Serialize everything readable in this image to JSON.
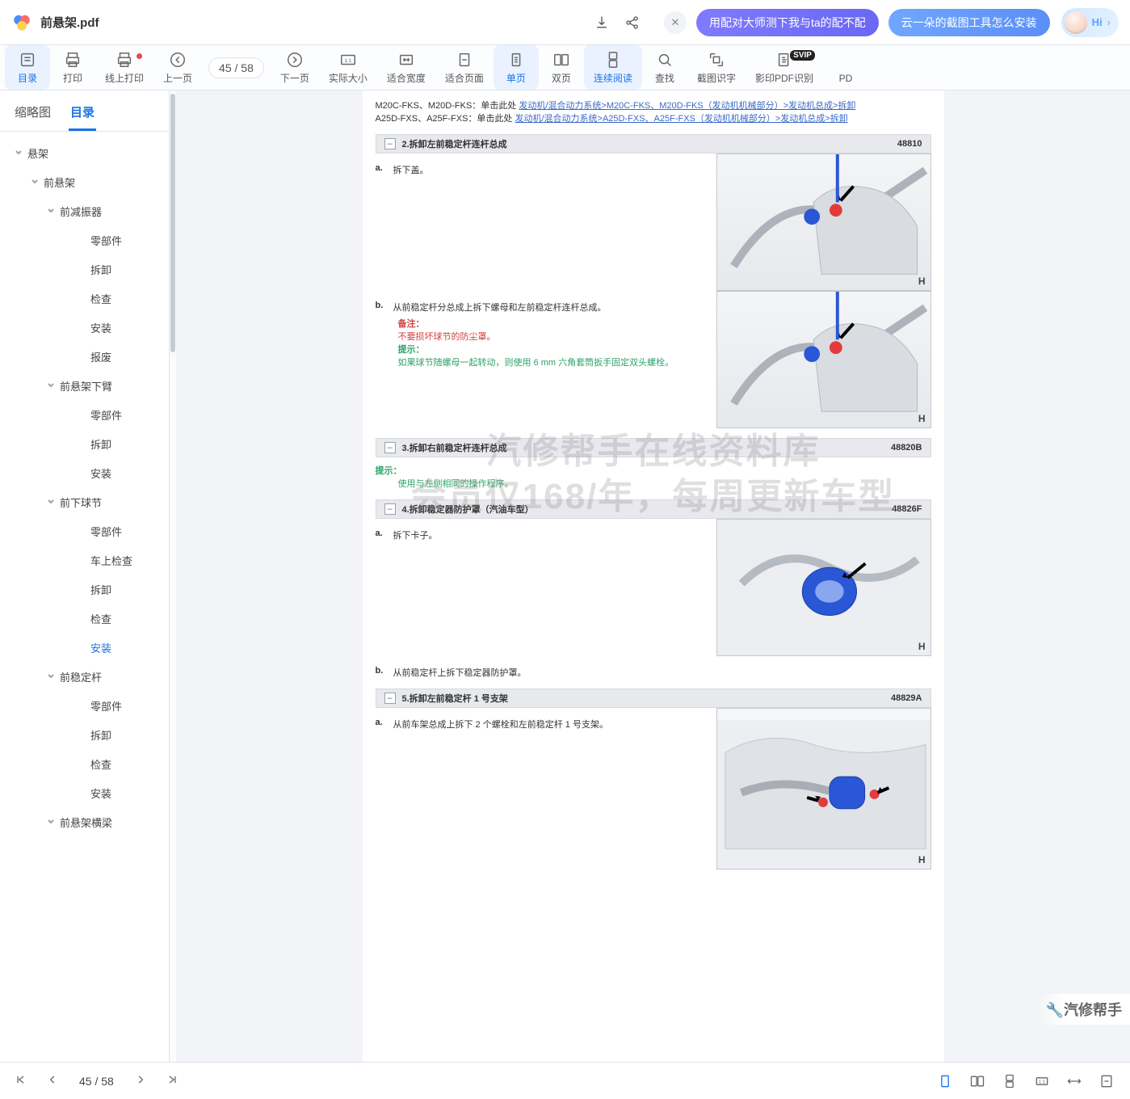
{
  "title": "前悬架.pdf",
  "titlebar": {
    "pills": [
      "用配对大师测下我与ta的配不配",
      "云一朵的截图工具怎么安装"
    ],
    "hi": "Hi"
  },
  "toolbar": {
    "items": [
      {
        "id": "toc",
        "label": "目录",
        "icon": "toc",
        "active": true
      },
      {
        "id": "print",
        "label": "打印",
        "icon": "print"
      },
      {
        "id": "print-online",
        "label": "线上打印",
        "icon": "print",
        "dot": true
      },
      {
        "id": "prev-page",
        "label": "上一页",
        "icon": "chev-l"
      },
      {
        "id": "page-ind",
        "kind": "page-ind"
      },
      {
        "id": "next-page",
        "label": "下一页",
        "icon": "chev-r"
      },
      {
        "id": "actual",
        "label": "实际大小",
        "icon": "onebyone"
      },
      {
        "id": "fit-w",
        "label": "适合宽度",
        "icon": "fit-w"
      },
      {
        "id": "fit-page",
        "label": "适合页面",
        "icon": "fit-page"
      },
      {
        "id": "single",
        "label": "单页",
        "icon": "single",
        "active": true
      },
      {
        "id": "double",
        "label": "双页",
        "icon": "double"
      },
      {
        "id": "cont",
        "label": "连续阅读",
        "icon": "cont",
        "active": true
      },
      {
        "id": "find",
        "label": "查找",
        "icon": "search"
      },
      {
        "id": "ocr",
        "label": "截图识字",
        "icon": "crop"
      },
      {
        "id": "copy-ocr",
        "label": "影印PDF识别",
        "icon": "copyocr",
        "badge": "SVIP"
      },
      {
        "id": "pdf-truncated",
        "label": "PD",
        "icon": "none"
      }
    ],
    "page_current": "45",
    "page_sep": " / ",
    "page_total": "58"
  },
  "sidebar": {
    "tabs": {
      "thumbs": "缩略图",
      "toc": "目录"
    },
    "tree": [
      {
        "level": 0,
        "label": "悬架",
        "expandable": true
      },
      {
        "level": 1,
        "label": "前悬架",
        "expandable": true
      },
      {
        "level": 2,
        "label": "前减振器",
        "expandable": true
      },
      {
        "level": 3,
        "label": "零部件"
      },
      {
        "level": 3,
        "label": "拆卸"
      },
      {
        "level": 3,
        "label": "检查"
      },
      {
        "level": 3,
        "label": "安装"
      },
      {
        "level": 3,
        "label": "报废"
      },
      {
        "level": 2,
        "label": "前悬架下臂",
        "expandable": true
      },
      {
        "level": 3,
        "label": "零部件"
      },
      {
        "level": 3,
        "label": "拆卸"
      },
      {
        "level": 3,
        "label": "安装"
      },
      {
        "level": 2,
        "label": "前下球节",
        "expandable": true
      },
      {
        "level": 3,
        "label": "零部件"
      },
      {
        "level": 3,
        "label": "车上检查"
      },
      {
        "level": 3,
        "label": "拆卸"
      },
      {
        "level": 3,
        "label": "检查"
      },
      {
        "level": 3,
        "label": "安装",
        "selected": true
      },
      {
        "level": 2,
        "label": "前稳定杆",
        "expandable": true
      },
      {
        "level": 3,
        "label": "零部件"
      },
      {
        "level": 3,
        "label": "拆卸"
      },
      {
        "level": 3,
        "label": "检查"
      },
      {
        "level": 3,
        "label": "安装"
      },
      {
        "level": 2,
        "label": "前悬架横梁",
        "expandable": true
      }
    ]
  },
  "doc": {
    "meta": [
      {
        "prefix": "M20C-FKS、M20D-FKS：单击此处 ",
        "link": "发动机/混合动力系统>M20C-FKS、M20D-FKS（发动机机械部分）>发动机总成>拆卸"
      },
      {
        "prefix": "A25D-FXS、A25F-FXS：单击此处 ",
        "link": "发动机/混合动力系统>A25D-FXS、A25F-FXS（发动机机械部分）>发动机总成>拆卸"
      }
    ],
    "sections": [
      {
        "title": "2.拆卸左前稳定杆连杆总成",
        "code": "48810",
        "steps": [
          {
            "lbl": "a.",
            "text": "拆下盖。"
          },
          {
            "lbl": "b.",
            "text": "从前稳定杆分总成上拆下螺母和左前稳定杆连杆总成。",
            "notes": [
              {
                "kind": "red",
                "tag": "备注：",
                "text": "不要损坏球节的防尘罩。"
              },
              {
                "kind": "teal",
                "tag": "提示：",
                "text": "如果球节随螺母一起转动，则使用 6 mm 六角套筒扳手固定双头螺栓。"
              }
            ]
          }
        ]
      },
      {
        "title": "3.拆卸右前稳定杆连杆总成",
        "code": "48820B",
        "leading_note": {
          "kind": "teal",
          "tag": "提示：",
          "text": "使用与左侧相同的操作程序。"
        }
      },
      {
        "title": "4.拆卸稳定器防护罩（汽油车型）",
        "code": "48826F",
        "steps": [
          {
            "lbl": "a.",
            "text": "拆下卡子。"
          },
          {
            "lbl": "b.",
            "text": "从前稳定杆上拆下稳定器防护罩。"
          }
        ]
      },
      {
        "title": "5.拆卸左前稳定杆 1 号支架",
        "code": "48829A",
        "steps": [
          {
            "lbl": "a.",
            "text": "从前车架总成上拆下 2 个螺栓和左前稳定杆 1 号支架。"
          }
        ]
      }
    ],
    "watermarks": [
      "汽修帮手在线资料库",
      "会员仅168/年，每周更新车型"
    ],
    "corner_brand": "汽修帮手"
  },
  "bottombar": {
    "page_current": "45",
    "page_sep": " / ",
    "page_total": "58"
  }
}
